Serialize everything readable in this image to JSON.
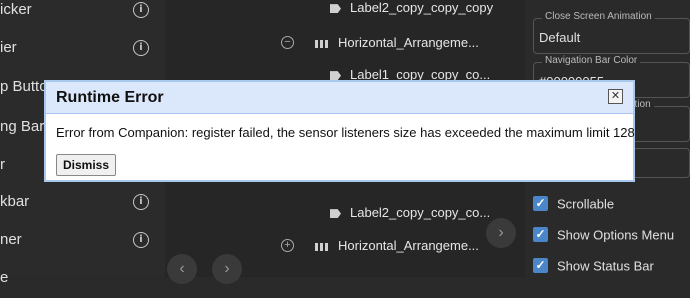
{
  "palette": {
    "items": [
      {
        "label": "icker"
      },
      {
        "label": "ier"
      },
      {
        "label": "p Button"
      },
      {
        "label": "ng Bar"
      },
      {
        "label": "r"
      },
      {
        "label": "kbar"
      },
      {
        "label": "ner"
      },
      {
        "label": "e"
      }
    ]
  },
  "tree": {
    "rows": [
      {
        "label": "Label2_copy_copy_copy"
      },
      {
        "label": "Horizontal_Arrangeme..."
      },
      {
        "label": "Label1_copy_copy_co..."
      },
      {
        "label": "Label2_copy_copy_co..."
      },
      {
        "label": "Horizontal_Arrangeme..."
      }
    ],
    "collapse_glyph": "−",
    "expand_glyph": "+"
  },
  "props": {
    "close_animation": {
      "legend": "Close Screen Animation",
      "value": "Default"
    },
    "nav_bar_color": {
      "legend": "Navigation Bar Color",
      "value": "#00000055"
    },
    "partial_legend": "ation",
    "checkboxes": [
      {
        "label": "Scrollable",
        "checked": true
      },
      {
        "label": "Show Options Menu",
        "checked": true
      },
      {
        "label": "Show Status Bar",
        "checked": true
      }
    ]
  },
  "modal": {
    "title": "Runtime Error",
    "message": "Error from Companion: register failed, the sensor listeners size has exceeded the maximum limit 128",
    "dismiss_label": "Dismiss",
    "close_glyph": "✕"
  },
  "colors": {
    "accent": "#4a86c8",
    "modal_header": "#dbe8fb"
  }
}
